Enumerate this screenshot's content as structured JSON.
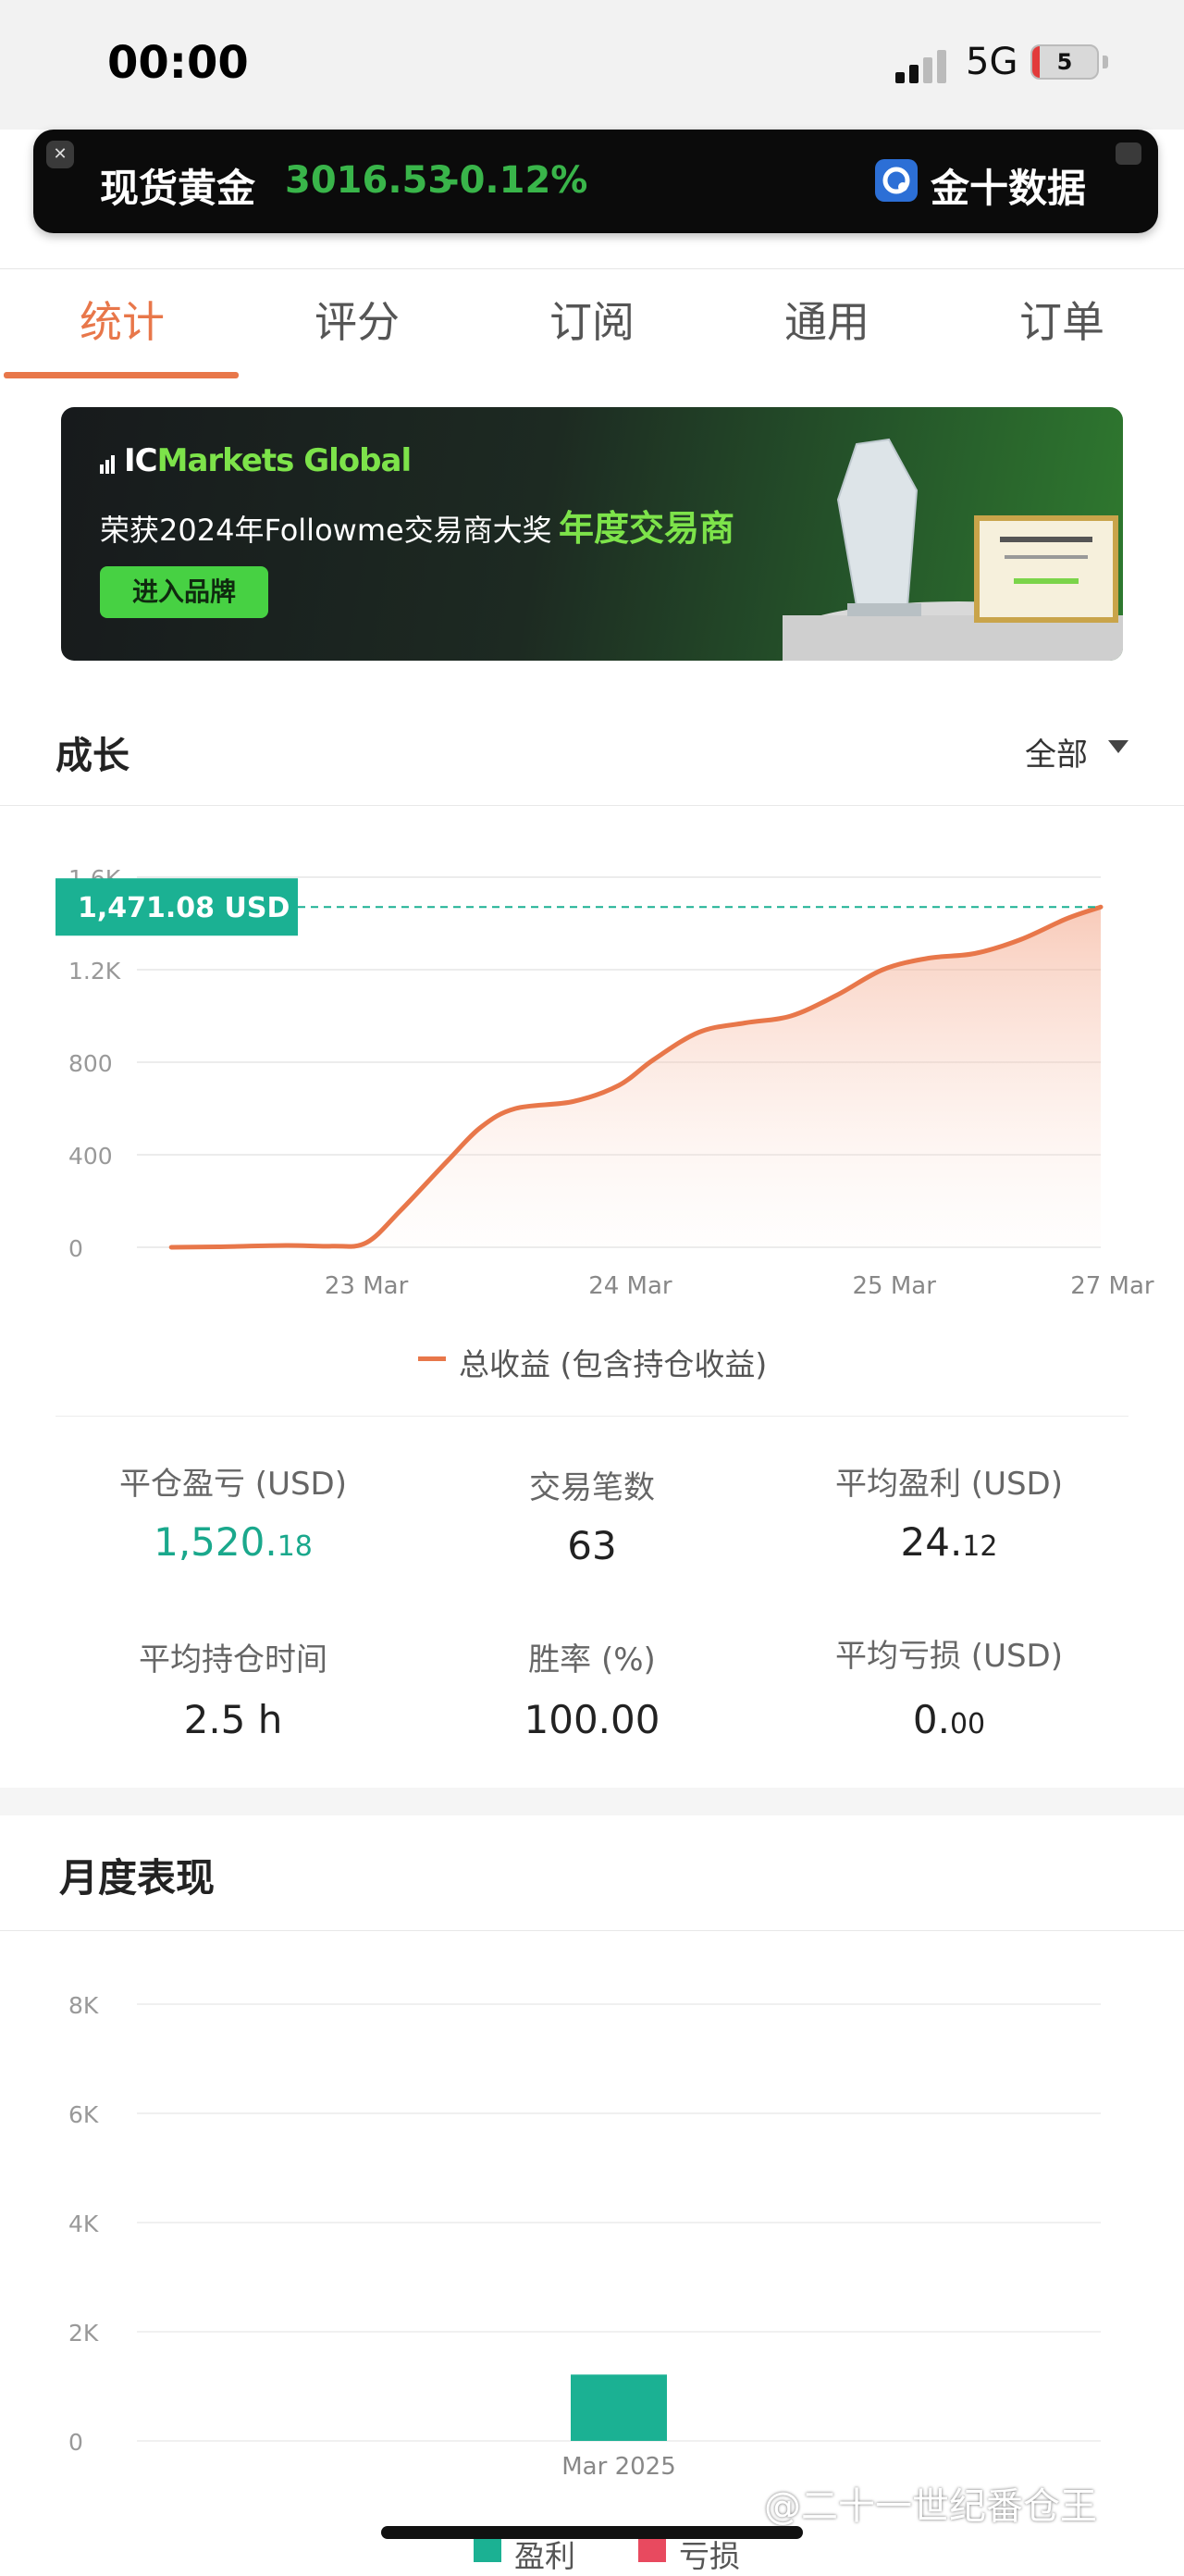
{
  "status_bar": {
    "time": "00:00",
    "network": "5G",
    "battery": "5"
  },
  "ticker": {
    "name": "现货黄金",
    "price": "3016.53",
    "change": "-0.12%",
    "brand": "金十数据"
  },
  "tabs": [
    "统计",
    "评分",
    "订阅",
    "通用",
    "订单"
  ],
  "banner": {
    "logo_prefix": "IC",
    "logo_rest": "Markets Global",
    "text": "荣获2024年Followme交易商大奖",
    "highlight": "年度交易商",
    "button": "进入品牌"
  },
  "growth": {
    "title": "成长",
    "filter": "全部",
    "current_label": "1,471.08 USD",
    "legend": "总收益 (包含持仓收益)"
  },
  "colors": {
    "accent": "#e8774a",
    "profit": "#1bb193",
    "loss": "#e84a5f",
    "ticker_green": "#39b54a"
  },
  "chart_data": [
    {
      "type": "area",
      "series": [
        {
          "name": "总收益 (包含持仓收益)",
          "values": [
            0,
            2,
            8,
            5,
            20,
            160,
            370,
            520,
            600,
            630,
            700,
            810,
            930,
            970,
            1000,
            1090,
            1200,
            1250,
            1270,
            1330,
            1420,
            1471.08
          ]
        }
      ],
      "x": [
        0,
        0.2,
        0.5,
        0.7,
        0.85,
        1.0,
        1.2,
        1.35,
        1.5,
        1.75,
        1.95,
        2.1,
        2.3,
        2.5,
        2.7,
        2.9,
        3.1,
        3.3,
        3.5,
        3.7,
        3.9,
        4.05
      ],
      "x_ticks": [
        {
          "x": 0.85,
          "label": "23 Mar"
        },
        {
          "x": 2.0,
          "label": "24 Mar"
        },
        {
          "x": 3.15,
          "label": "25 Mar"
        },
        {
          "x": 4.1,
          "label": "27 Mar"
        }
      ],
      "y_ticks": [
        "0",
        "400",
        "800",
        "1.2K",
        "1.6K"
      ],
      "ylim": [
        0,
        1600
      ],
      "xlim": [
        -0.15,
        4.05
      ],
      "current_value": 1471.08
    },
    {
      "type": "bar",
      "categories": [
        "Mar 2025"
      ],
      "series": [
        {
          "name": "盈利",
          "values": [
            1215
          ]
        },
        {
          "name": "亏损",
          "values": [
            0
          ]
        }
      ],
      "y_ticks": [
        "0",
        "2K",
        "4K",
        "6K",
        "8K"
      ],
      "ylim": [
        0,
        8000
      ]
    }
  ],
  "stats": [
    {
      "label": "平仓盈亏 (USD)",
      "int": "1,520.",
      "dec": "18"
    },
    {
      "label": "交易笔数",
      "int": "63",
      "dec": ""
    },
    {
      "label": "平均盈利 (USD)",
      "int": "24.",
      "dec": "12"
    },
    {
      "label": "平均持仓时间",
      "int": "2.5 h",
      "dec": ""
    },
    {
      "label": "胜率 (%)",
      "int": "100.00",
      "dec": ""
    },
    {
      "label": "平均亏损 (USD)",
      "int": "0.",
      "dec": "00"
    }
  ],
  "monthly": {
    "title": "月度表现",
    "legend_profit": "盈利",
    "legend_loss": "亏损"
  },
  "watermark": "@二十一世纪番仓王"
}
